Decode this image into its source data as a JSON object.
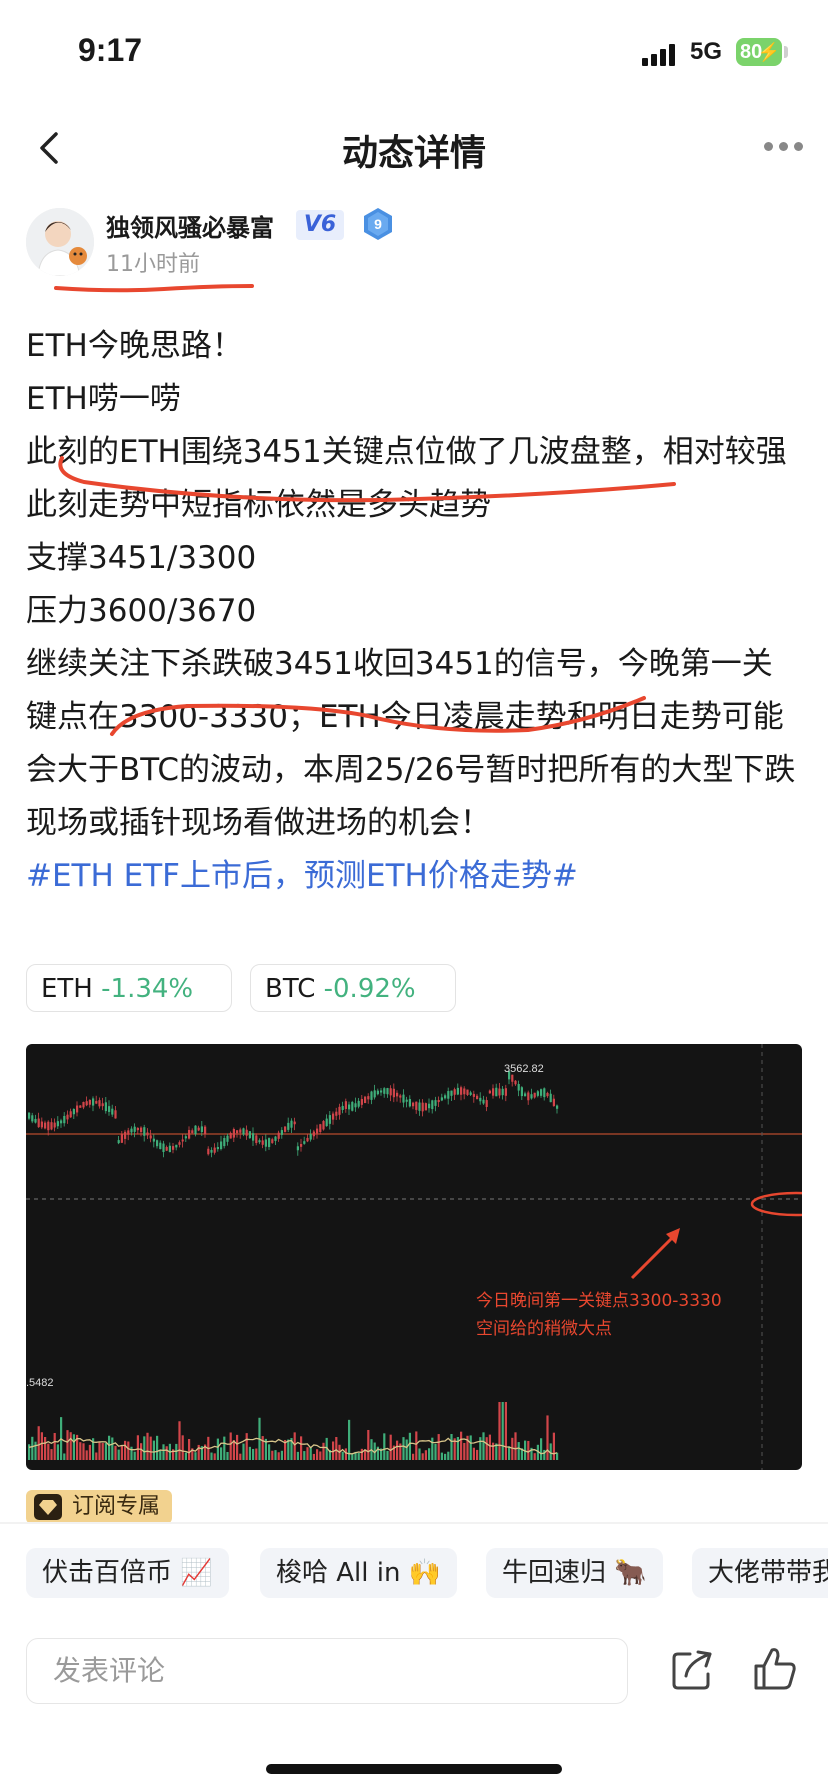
{
  "status_bar": {
    "time": "9:17",
    "network": "5G",
    "battery": "80"
  },
  "nav": {
    "title": "动态详情"
  },
  "author": {
    "name": "独领风骚必暴富",
    "vip_badge": "V6",
    "level_badge": "9",
    "post_time": "11小时前"
  },
  "post": {
    "lines": [
      "ETH今晚思路！",
      "ETH唠一唠",
      "此刻的ETH围绕3451关键点位做了几波盘整，相对较强",
      "此刻走势中短指标依然是多头趋势",
      "支撑3451/3300",
      "压力3600/3670",
      "继续关注下杀跌破3451收回3451的信号，今晚第一关键点在3300-3330；ETH今日凌晨走势和明日走势可能会大于BTC的波动，本周25/26号暂时把所有的大型下跌现场或插针现场看做进场的机会！"
    ],
    "hashtag": "#ETH ETF上市后，预测ETH价格走势#"
  },
  "tickers": [
    {
      "symbol": "ETH",
      "change": "-1.34%"
    },
    {
      "symbol": "BTC",
      "change": "-0.92%"
    }
  ],
  "chart_image": {
    "peak_label": "3562.82",
    "volume_label": ".5482",
    "annotation_line1": "今日晚间第一关键点3300-3330",
    "annotation_line2": "空间给的稍微大点"
  },
  "subscription_tag": "订阅专属",
  "topic_chips": [
    "伏击百倍币 📈",
    "梭哈 All in 🙌",
    "牛回速归 🐂",
    "大佬带带我"
  ],
  "comment_bar": {
    "placeholder": "发表评论"
  },
  "colors": {
    "hashtag": "#3b6bd6",
    "change": "#43b27f",
    "annotation": "#e8472f",
    "chart_bg": "#141414"
  }
}
